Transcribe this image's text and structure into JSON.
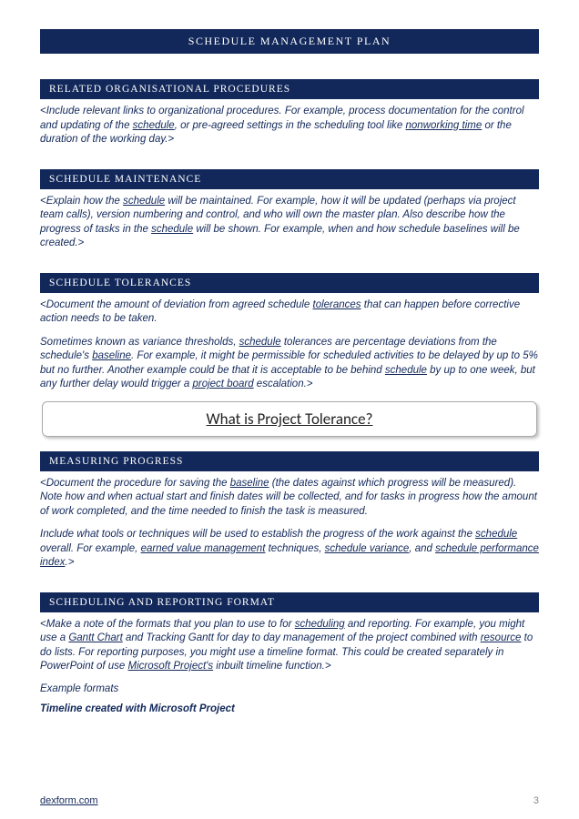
{
  "header": {
    "title": "SCHEDULE MANAGEMENT PLAN"
  },
  "sections": {
    "relatedProcedures": {
      "heading": "RELATED ORGANISATIONAL PROCEDURES",
      "p1a": "<Include relevant links to organizational procedures. For example, process documentation for the control and updating of the ",
      "link1": "schedule",
      "p1b": ", or pre-agreed settings in the scheduling tool like ",
      "link2": "nonworking time",
      "p1c": " or the duration of the working day.>"
    },
    "maintenance": {
      "heading": "SCHEDULE MAINTENANCE",
      "p1a": "<Explain how the ",
      "link1": "schedule",
      "p1b": " will be maintained. For example, how it will be updated (perhaps via project team calls), version numbering and control, and who will own the master plan. Also describe how the progress of tasks in the ",
      "link2": "schedule",
      "p1c": " will be shown. For example, when and how schedule baselines will be created.>"
    },
    "tolerances": {
      "heading": "SCHEDULE TOLERANCES",
      "p1a": "<Document the amount of deviation from agreed schedule ",
      "link1": "tolerances",
      "p1b": " that can happen before corrective action needs to be taken.",
      "p2a": "Sometimes known as variance thresholds, ",
      "link2": "schedule",
      "p2b": " tolerances are percentage deviations from the schedule's ",
      "link3": "baseline",
      "p2c": ". For example, it might be permissible for scheduled activities to be delayed by up to 5% but no further. Another example could be that it is acceptable to be behind ",
      "link4": "schedule",
      "p2d": " by up to one week, but any further delay would trigger a ",
      "link5": "project board",
      "p2e": " escalation.>",
      "callout": "What is Project Tolerance?"
    },
    "measuring": {
      "heading": "MEASURING PROGRESS",
      "p1a": "<Document the procedure for saving the ",
      "link1": "baseline",
      "p1b": " (the dates against which progress will be measured). Note how and when actual start and finish dates will be collected, and for tasks in progress how the amount of work completed, and the time needed to finish the task is measured.",
      "p2a": "Include what tools or techniques will be used to establish the progress of the work against the ",
      "link2": "schedule",
      "p2b": " overall. For example, ",
      "link3": "earned value management",
      "p2c": " techniques, ",
      "link4": "schedule variance",
      "p2d": ", and ",
      "link5": "schedule performance index",
      "p2e": ".>"
    },
    "reporting": {
      "heading": "SCHEDULING AND REPORTING FORMAT",
      "p1a": "<Make a note of the formats that you plan to use to for ",
      "link1": "scheduling",
      "p1b": " and reporting. For example, you might use a ",
      "link2": "Gantt Chart",
      "p1c": " and Tracking Gantt for day to day management of the project combined with ",
      "link3": "resource",
      "p1d": " to do lists. For reporting purposes, you might use a timeline format. This could be created separately in PowerPoint of use ",
      "link4": "Microsoft Project's",
      "p1e": " inbuilt timeline function.>",
      "example": "Example formats",
      "timeline": "Timeline created with Microsoft Project"
    }
  },
  "footer": {
    "site": "dexform.com",
    "page": "3"
  }
}
